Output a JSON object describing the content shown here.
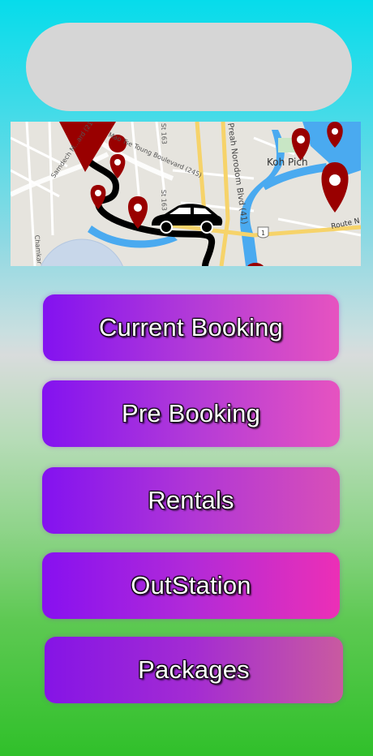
{
  "header": {
    "pill_text": ""
  },
  "map": {
    "labels": {
      "koh_pich": "Koh Pich",
      "preah_norodom": "Preah Norodom Blvd (41)",
      "mao_tse_toung": "Mao Tse Toung Boulevard (245)",
      "samdech": "Samdech M...ard (217)",
      "st163_a": "St 163",
      "st163_b": "St 163",
      "route_no": "Route N",
      "road_shield": "1",
      "chamkar": "Chamkar"
    }
  },
  "menu": {
    "items": [
      {
        "label": "Current Booking"
      },
      {
        "label": "Pre Booking"
      },
      {
        "label": "Rentals"
      },
      {
        "label": "OutStation"
      },
      {
        "label": "Packages"
      }
    ]
  },
  "colors": {
    "pin": "#990000",
    "button_start": "#8312f0",
    "button_end": "#e653c0"
  }
}
